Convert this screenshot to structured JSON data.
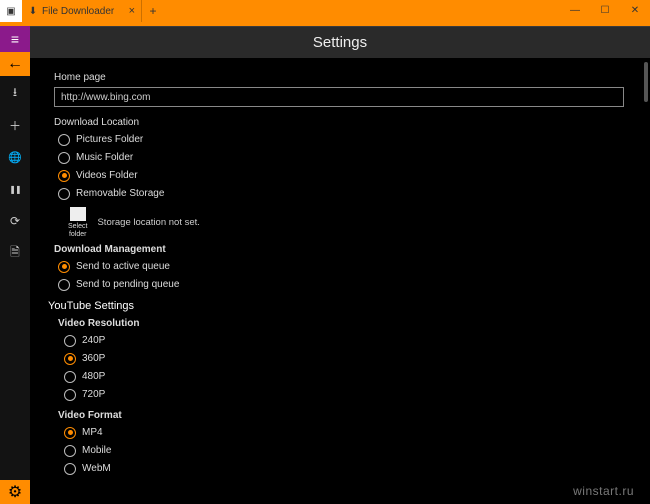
{
  "titlebar": {
    "tab_title": "File Downloader",
    "tab_app_glyph": "▣",
    "tab_favicon": "⬇",
    "tab_close": "×",
    "new_tab": "+",
    "min": "—",
    "max": "☐",
    "close": "✕"
  },
  "sidebar": {
    "hamburger": "≡",
    "back": "←",
    "download": "⭳",
    "add": "＋",
    "globe": "🌐",
    "pause": "❚❚",
    "history": "⟳",
    "copy": "🗎",
    "gear": "⚙"
  },
  "header": {
    "title": "Settings"
  },
  "home_page": {
    "label": "Home page",
    "value": "http://www.bing.com"
  },
  "download_location": {
    "label": "Download Location",
    "options": [
      {
        "label": "Pictures Folder",
        "selected": false
      },
      {
        "label": "Music Folder",
        "selected": false
      },
      {
        "label": "Videos Folder",
        "selected": true
      },
      {
        "label": "Removable Storage",
        "selected": false
      }
    ],
    "select_folder_label_1": "Select",
    "select_folder_label_2": "folder",
    "storage_message": "Storage location not set."
  },
  "download_management": {
    "label": "Download Management",
    "options": [
      {
        "label": "Send to active queue",
        "selected": true
      },
      {
        "label": "Send to pending queue",
        "selected": false
      }
    ]
  },
  "youtube": {
    "label": "YouTube Settings",
    "resolution": {
      "label": "Video Resolution",
      "options": [
        {
          "label": "240P",
          "selected": false
        },
        {
          "label": "360P",
          "selected": true
        },
        {
          "label": "480P",
          "selected": false
        },
        {
          "label": "720P",
          "selected": false
        }
      ]
    },
    "format": {
      "label": "Video Format",
      "options": [
        {
          "label": "MP4",
          "selected": true
        },
        {
          "label": "Mobile",
          "selected": false
        },
        {
          "label": "WebM",
          "selected": false
        }
      ]
    }
  },
  "watermark": "winstart.ru"
}
